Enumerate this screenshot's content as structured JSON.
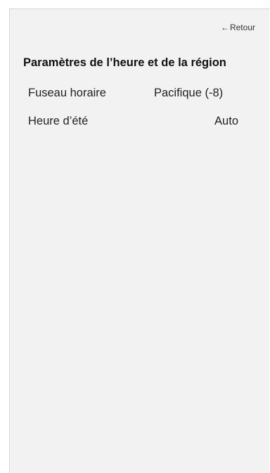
{
  "header": {
    "back_arrow": "←",
    "back_label": "Retour"
  },
  "page": {
    "title": "Paramètres de l’heure et de la région"
  },
  "settings": [
    {
      "label": "Fuseau horaire",
      "value": "Pacifique (-8)"
    },
    {
      "label": "Heure d’été",
      "value": "Auto"
    }
  ],
  "colors": {
    "panel_background": "#f2f2f2",
    "text": "#222222"
  }
}
